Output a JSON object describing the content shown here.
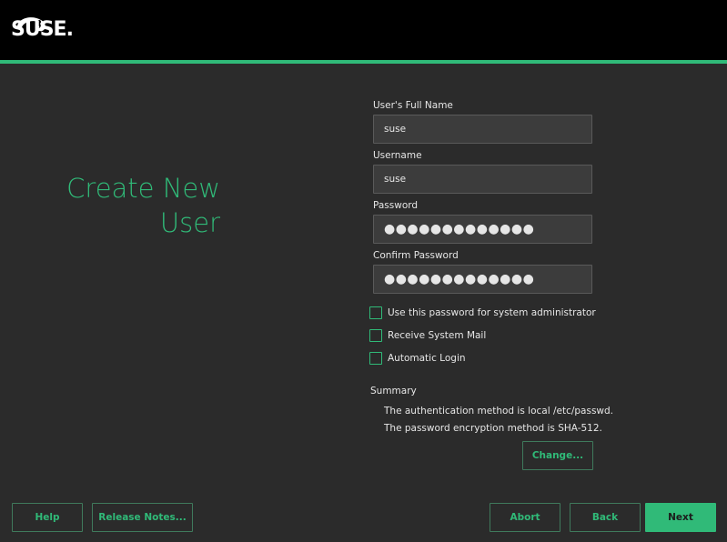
{
  "header": {
    "brand": "SUSE.",
    "logo_icon": "chameleon-icon",
    "accent_color": "#30ba78"
  },
  "page": {
    "title_line1": "Create New",
    "title_line2": "User"
  },
  "form": {
    "full_name": {
      "label": "User's Full Name",
      "value": "suse"
    },
    "username": {
      "label": "Username",
      "value": "suse"
    },
    "password": {
      "label": "Password",
      "value": "●●●●●●●●●●●●●"
    },
    "confirm_password": {
      "label": "Confirm Password",
      "value": "●●●●●●●●●●●●●"
    }
  },
  "options": {
    "use_for_admin": {
      "label": "Use this password for system administrator",
      "checked": false
    },
    "receive_mail": {
      "label": "Receive System Mail",
      "checked": false
    },
    "auto_login": {
      "label": "Automatic Login",
      "checked": false
    }
  },
  "summary": {
    "title": "Summary",
    "line1": "The authentication method is local /etc/passwd.",
    "line2": "The password encryption method is SHA-512.",
    "change_label": "Change..."
  },
  "footer": {
    "help": "Help",
    "release_notes": "Release Notes...",
    "abort": "Abort",
    "back": "Back",
    "next": "Next"
  }
}
